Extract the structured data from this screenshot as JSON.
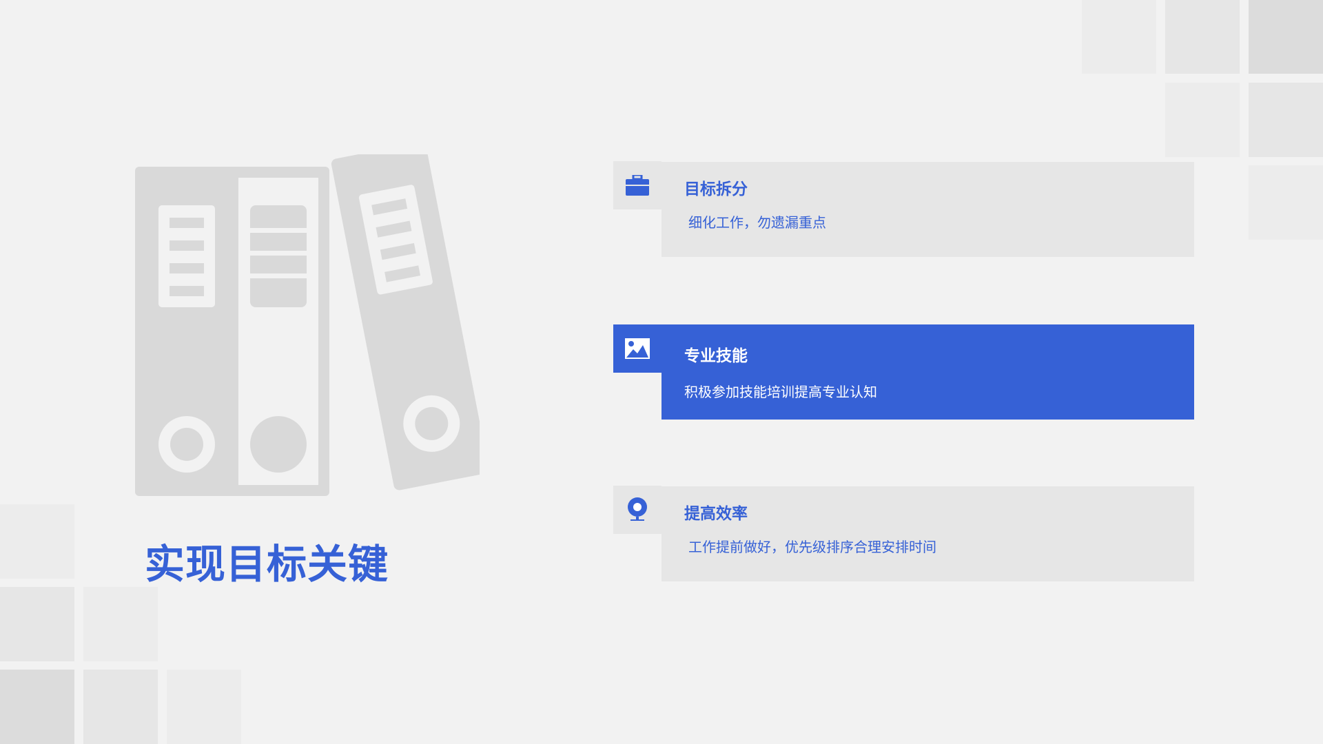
{
  "slide": {
    "title": "实现目标关键",
    "accent_color": "#3661d6",
    "card_color": "#e6e6e6",
    "background_color": "#f2f2f2"
  },
  "illustration": {
    "icon": "binders-icon"
  },
  "items": [
    {
      "title": "目标拆分",
      "desc": "细化工作，勿遗漏重点",
      "icon": "briefcase-icon",
      "active": false
    },
    {
      "title": "专业技能",
      "desc": "积极参加技能培训提高专业认知",
      "icon": "image-icon",
      "active": true
    },
    {
      "title": "提高效率",
      "desc": "工作提前做好，优先级排序合理安排时间",
      "icon": "webcam-icon",
      "active": false
    }
  ]
}
